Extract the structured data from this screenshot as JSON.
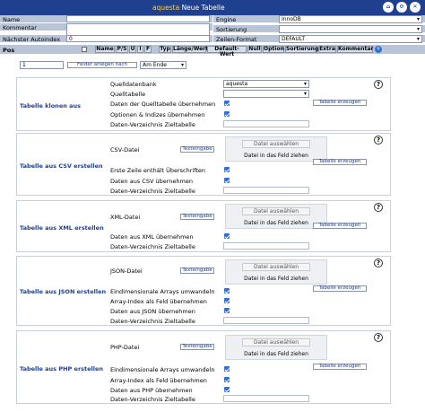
{
  "title": {
    "app": "aquesta",
    "text": "Neue Tabelle"
  },
  "title_buttons": [
    "home-icon",
    "gear-icon",
    "close-icon"
  ],
  "header": {
    "name_label": "Name",
    "kommentar_label": "Kommentar",
    "autoindex_label": "Nächster Autoindex",
    "autoindex_value": "0",
    "engine_label": "Engine",
    "engine_value": "InnoDB",
    "sortierung_label": "Sortierung",
    "zeilenformat_label": "Zeilen-Format",
    "zeilenformat_value": "DEFAULT"
  },
  "columns": {
    "pos": "Pos",
    "headers": [
      "Name",
      "P/S",
      "U",
      "I",
      "F",
      "Typ",
      "Länge/Wert",
      "Default-Wert",
      "Null",
      "Option",
      "Sortierung",
      "Extra",
      "Kommentar"
    ]
  },
  "add_fields": {
    "count": "1",
    "button": "Felder anlegen nach",
    "position": "Am Ende"
  },
  "klonen": {
    "title": "Tabelle klonen aus",
    "db_label": "Quelldatenbank",
    "db_value": "aquesta",
    "table_label": "Quelltabelle",
    "data_label": "Daten der Quelltabelle übernehmen",
    "options_label": "Optionen & Indizes übernehmen",
    "dir_label": "Daten-Verzeichnis Zieltabelle",
    "button": "Tabelle erzeugen"
  },
  "csv": {
    "title": "Tabelle aus CSV erstellen",
    "file_label": "CSV-Datei",
    "text_button": "Texteingabe",
    "file_button": "Datei auswählen",
    "drop_text": "Datei in das Feld ziehen",
    "first_row_label": "Erste Zeile enthält Überschriften",
    "data_label": "Daten aus CSV übernehmen",
    "dir_label": "Daten-Verzeichnis Zieltabelle",
    "button": "Tabelle erzeugen"
  },
  "xml": {
    "title": "Tabelle aus XML erstellen",
    "file_label": "XML-Datei",
    "text_button": "Texteingabe",
    "file_button": "Datei auswählen",
    "drop_text": "Datei in das Feld ziehen",
    "data_label": "Daten aus XML übernehmen",
    "dir_label": "Daten-Verzeichnis Zieltabelle",
    "button": "Tabelle erzeugen"
  },
  "json": {
    "title": "Tabelle aus JSON erstellen",
    "file_label": "JSON-Datei",
    "text_button": "Texteingabe",
    "file_button": "Datei auswählen",
    "drop_text": "Datei in das Feld ziehen",
    "multi_label": "Eindimensionale Arrays umwandeln",
    "index_label": "Array-Index als Feld übernehmen",
    "data_label": "Daten aus JSON übernehmen",
    "dir_label": "Daten-Verzeichnis Zieltabelle",
    "button": "Tabelle erzeugen"
  },
  "php": {
    "title": "Tabelle aus PHP erstellen",
    "file_label": "PHP-Datei",
    "text_button": "Texteingabe",
    "file_button": "Datei auswählen",
    "drop_text": "Datei in das Feld ziehen",
    "multi_label": "Eindimensionale Arrays umwandeln",
    "index_label": "Array-Index als Feld übernehmen",
    "data_label": "Daten aus PHP übernehmen",
    "dir_label": "Daten-Verzeichnis Zieltabelle",
    "button": "Tabelle erzeugen"
  },
  "help_glyph": "?",
  "colors": {
    "titlebar": "#1f3f8f",
    "accent": "#2f6fd6",
    "header": "#b9c4d6"
  }
}
